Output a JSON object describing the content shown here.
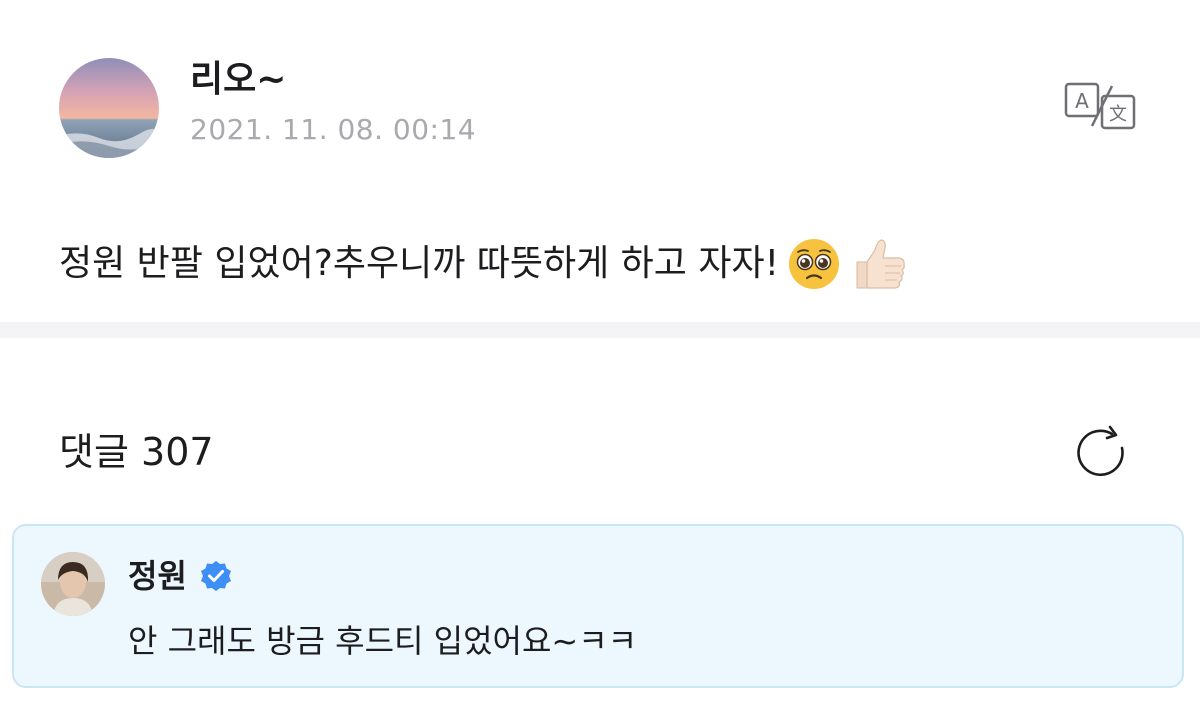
{
  "post": {
    "author": "리오~",
    "timestamp": "2021. 11. 08. 00:14",
    "avatar_icon": "sunset-ocean-avatar",
    "translate_icon": "translate-icon",
    "text": "정원 반팔 입었어?추우니까 따뜻하게 하고 자자!",
    "emojis": [
      "pleading-face-emoji",
      "thumbs-up-emoji"
    ]
  },
  "comments": {
    "label": "댓글",
    "count": "307",
    "refresh_icon": "refresh-icon"
  },
  "highlighted_comment": {
    "author": "정원",
    "verified_icon": "verified-badge-icon",
    "text": "안 그래도 방금 후드티 입었어요~ㅋㅋ",
    "avatar_icon": "profile-photo-avatar"
  },
  "colors": {
    "timestamp": "#a9a9ae",
    "divider": "#f4f4f7",
    "comment_bg": "#edf8fe",
    "comment_border": "#c9e6f4",
    "verified": "#3d8ff5"
  }
}
